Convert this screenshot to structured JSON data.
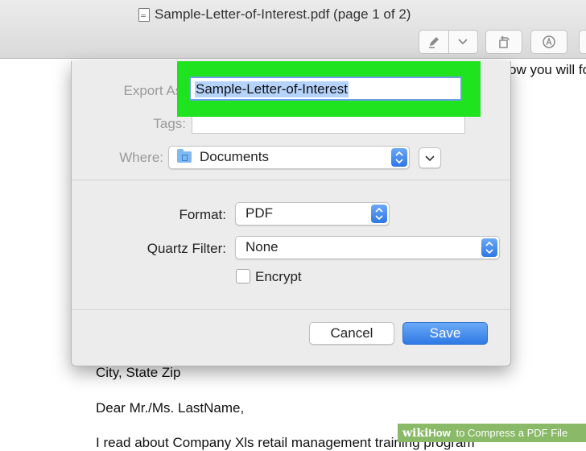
{
  "window": {
    "title": "Sample-Letter-of-Interest.pdf (page 1 of 2)",
    "toolbar_icons": [
      "pen-icon",
      "chevron-down-icon",
      "rotate-icon",
      "annotate-icon"
    ]
  },
  "document": {
    "partial_top_right": "ow you will fo",
    "line_city": "City, State Zip",
    "line_greeting": "Dear Mr./Ms. LastName,",
    "line_partial": "I read about Company Xls retail management training program"
  },
  "dialog": {
    "export_as_label": "Export As:",
    "export_as_value": "Sample-Letter-of-Interest",
    "tags_label": "Tags:",
    "tags_value": "",
    "where_label": "Where:",
    "where_value": "Documents",
    "format_label": "Format:",
    "format_value": "PDF",
    "quartz_label": "Quartz Filter:",
    "quartz_value": "None",
    "encrypt_label": "Encrypt",
    "encrypt_checked": false,
    "cancel_label": "Cancel",
    "save_label": "Save",
    "accent_color": "#2f7ae5",
    "highlight_color": "#20e320"
  },
  "watermark": {
    "brand": "wiki",
    "how": "How",
    "text": "to Compress a PDF File"
  }
}
